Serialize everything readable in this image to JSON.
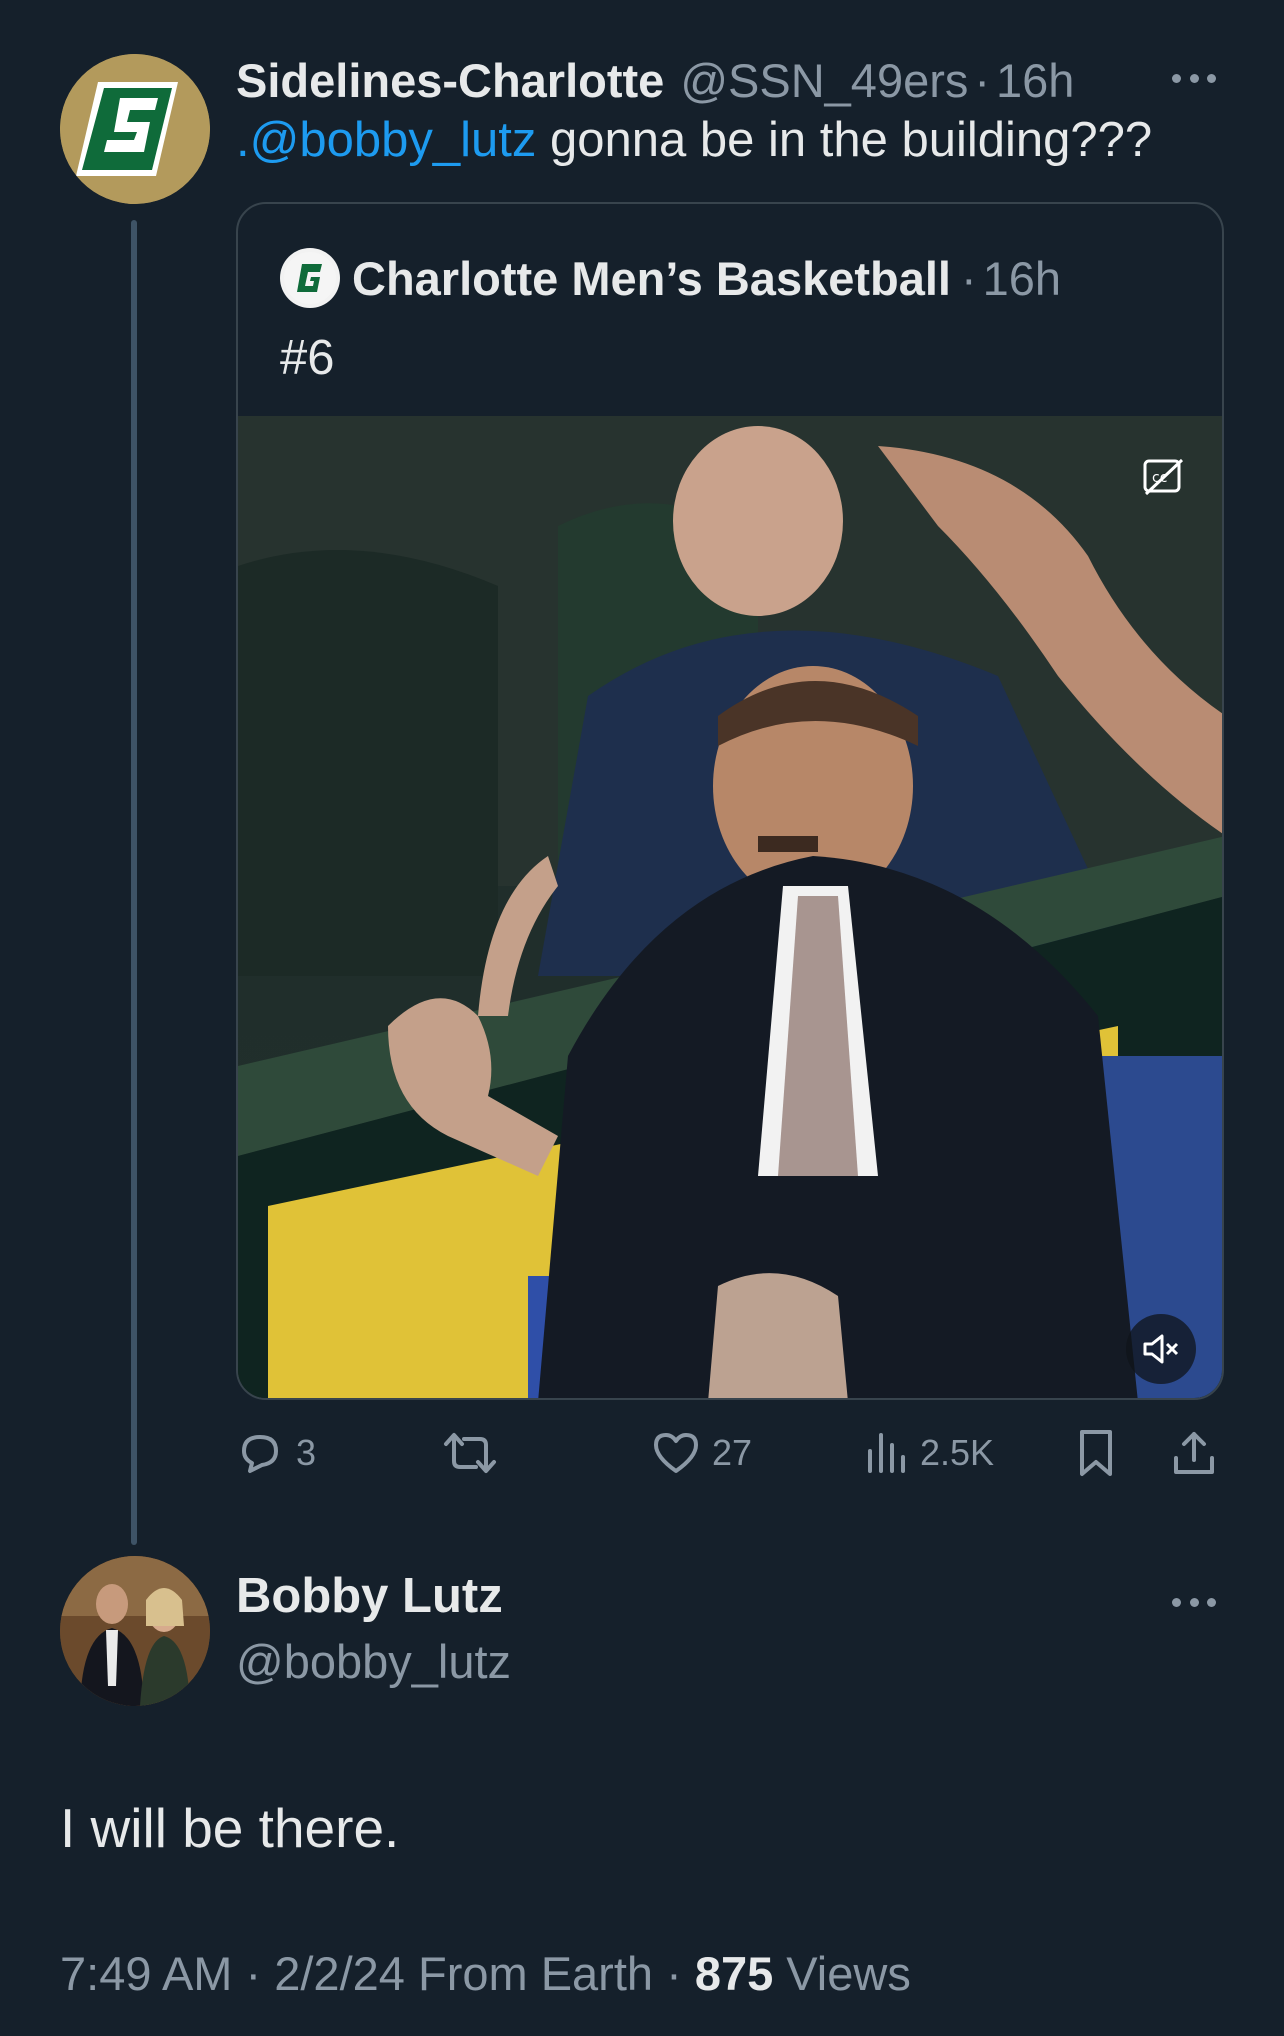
{
  "tweet": {
    "author_name": "Sidelines-Charlotte",
    "author_handle": "@SSN_49ers",
    "separator": "·",
    "time": "16h",
    "mention": ".@bobby_lutz",
    "text": " gonna be in the building???"
  },
  "quoted": {
    "author_name": "Charlotte Men’s Basketball",
    "separator": "·",
    "time": "16h",
    "text": "#6"
  },
  "actions": {
    "replies": "3",
    "retweets": "",
    "likes": "27",
    "views": "2.5K"
  },
  "reply": {
    "author_name": "Bobby Lutz",
    "author_handle": "@bobby_lutz",
    "text": "I will be there.",
    "time": "7:49 AM",
    "date": "2/2/24",
    "source": "From Earth",
    "views_count": "875",
    "views_label": "Views"
  },
  "colors": {
    "background": "#15202b",
    "mention": "#1d9bf0",
    "muted": "#8b98a5",
    "border": "#38444d"
  },
  "icons": [
    "more-icon",
    "reply-icon",
    "retweet-icon",
    "like-icon",
    "views-icon",
    "bookmark-icon",
    "share-icon",
    "captions-icon",
    "mute-icon"
  ]
}
